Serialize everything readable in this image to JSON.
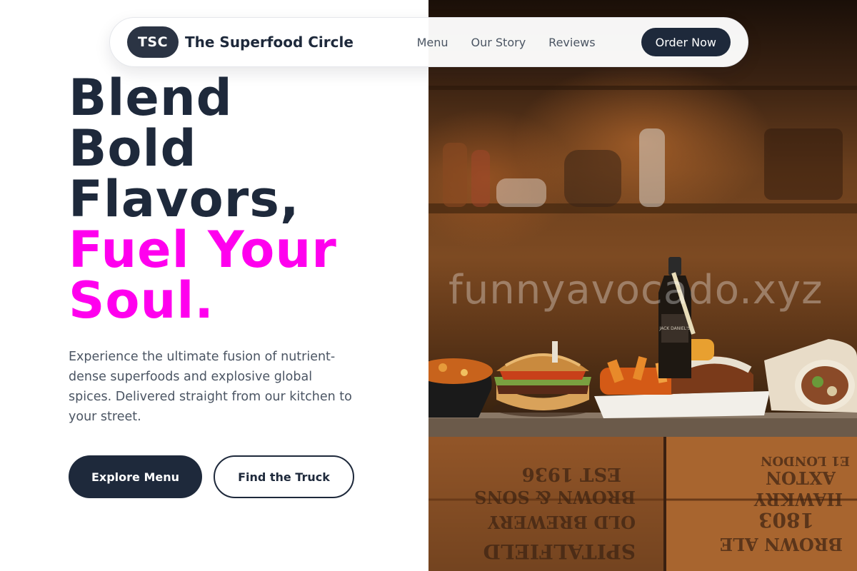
{
  "brand": {
    "badge": "TSC",
    "name": "The Superfood Circle"
  },
  "nav": {
    "links": [
      "Menu",
      "Our Story",
      "Reviews"
    ],
    "order_label": "Order Now"
  },
  "hero": {
    "title_lines": [
      "Blend",
      "Bold",
      "Flavors,"
    ],
    "accent_lines": [
      "Fuel Your",
      "Soul."
    ],
    "description": "Experience the ultimate fusion of nutrient-dense superfoods and explosive global spices. Delivered straight from our kitchen to your street.",
    "primary_cta": "Explore Menu",
    "secondary_cta": "Find the Truck"
  },
  "photo": {
    "watermark": "funnyavocado.xyz",
    "bottle_label": "JACK DANIEL'S",
    "crate_text_left": [
      "EST 1936",
      "BROWN & SONS",
      "OLD BREWERY",
      "SPITALFIELD"
    ],
    "crate_text_right": [
      "E1 LONDON",
      "AXTON",
      "HAWKRY",
      "1803",
      "BROWN ALE"
    ]
  },
  "colors": {
    "primary": "#1e293b",
    "accent": "#ff00ee",
    "text_muted": "#4b5563",
    "background": "#ffffff"
  }
}
